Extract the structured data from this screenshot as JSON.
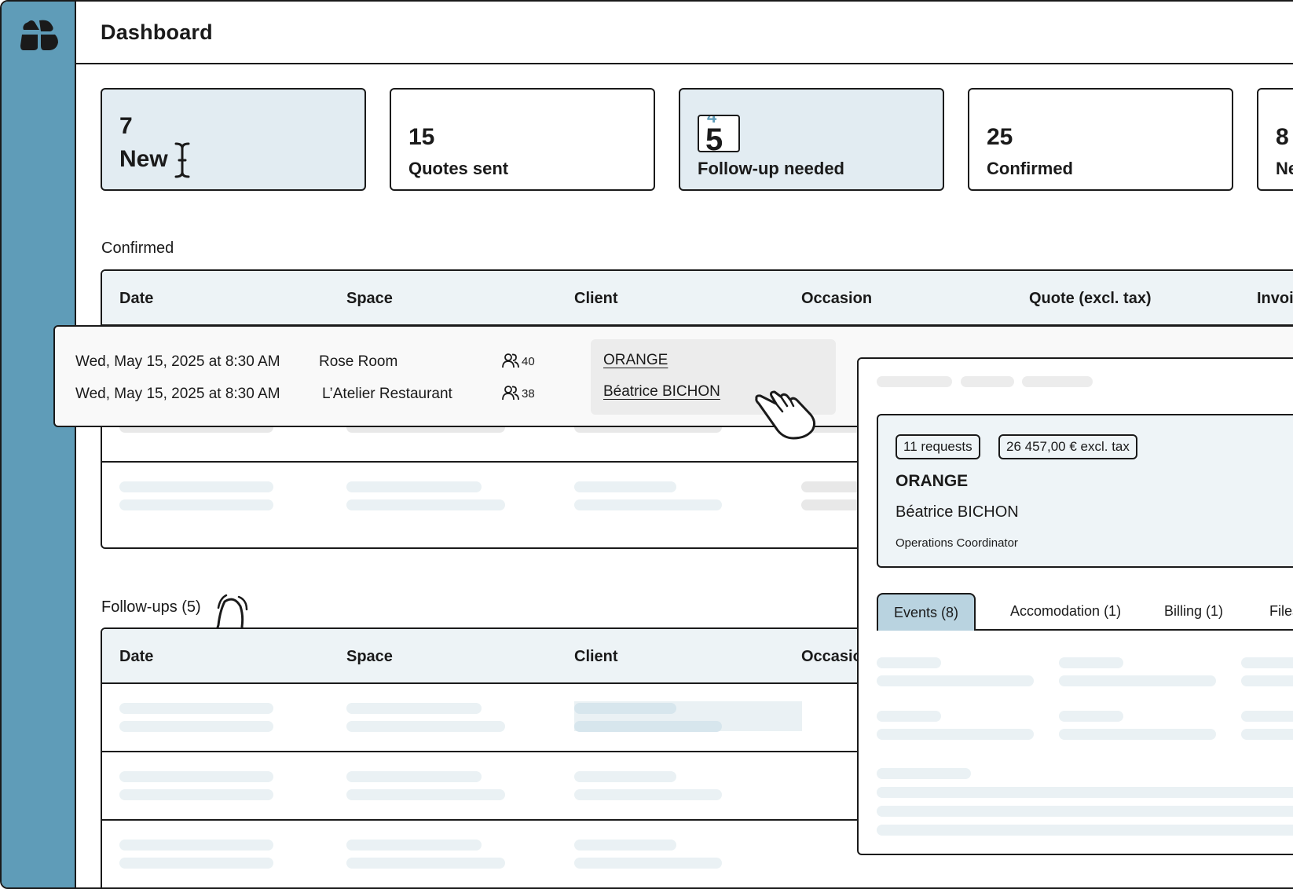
{
  "header": {
    "title": "Dashboard"
  },
  "stats": [
    {
      "value": "7",
      "label": "New"
    },
    {
      "value": "15",
      "label": "Quotes sent"
    },
    {
      "value_old": "4",
      "value": "5",
      "label": "Follow-up needed"
    },
    {
      "value": "25",
      "label": "Confirmed"
    },
    {
      "value": "8",
      "label": "Ne"
    }
  ],
  "confirmed": {
    "title": "Confirmed",
    "columns": [
      "Date",
      "Space",
      "Client",
      "Occasion",
      "Quote (excl. tax)",
      "Invoi"
    ]
  },
  "hover_rows": [
    {
      "date": "Wed, May 15, 2025 at 8:30 AM",
      "space": "Rose Room",
      "guests": "40",
      "client": "ORANGE"
    },
    {
      "date": "Wed, May 15, 2025 at 8:30 AM",
      "space": "L’Atelier Restaurant",
      "guests": "38",
      "client": "Béatrice BICHON"
    }
  ],
  "followups": {
    "title": "Follow-ups (5)",
    "columns": [
      "Date",
      "Space",
      "Client",
      "Occasio"
    ]
  },
  "client_detail": {
    "requests": "11 requests",
    "amount": "26 457,00 € excl. tax",
    "company": "ORANGE",
    "contact": "Béatrice BICHON",
    "role": "Operations Coordinator",
    "tabs": [
      "Events (8)",
      "Accomodation (1)",
      "Billing (1)",
      "Files"
    ]
  },
  "colors": {
    "sidebar": "#5f9cb8",
    "highlight": "#e2ecf2",
    "active_tab": "#b9d3e0"
  }
}
